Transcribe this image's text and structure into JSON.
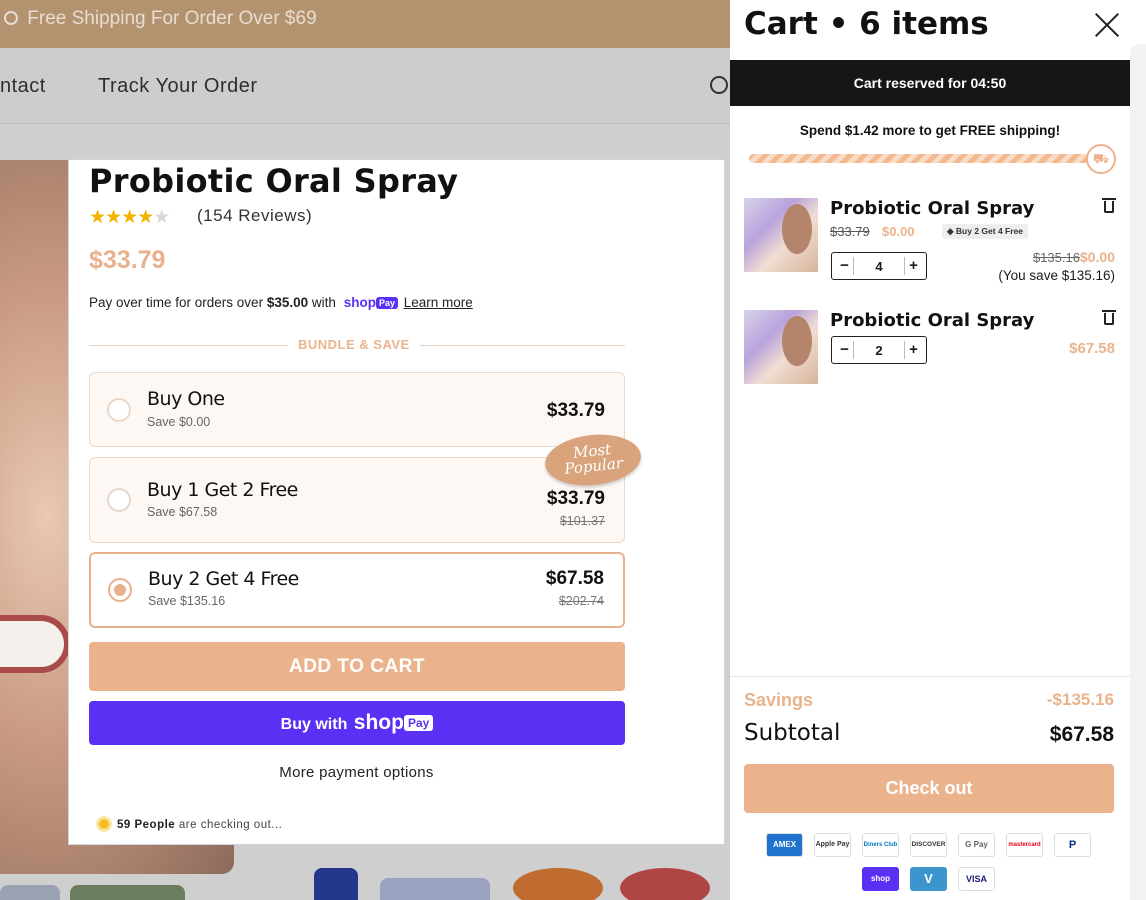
{
  "store": {
    "announcement": "Free Shipping For Order Over $69",
    "nav": [
      "ntact",
      "Track Your Order"
    ]
  },
  "product": {
    "title": "Probiotic Oral Spray",
    "rating": 4.5,
    "reviews": "(154 Reviews)",
    "price": "$33.79",
    "pay_over": {
      "prefix": "Pay over time for orders over",
      "amount": "$35.00",
      "with": "with",
      "shop": "shop",
      "pay": "Pay",
      "learn_more": "Learn more"
    },
    "bundle_label": "BUNDLE & SAVE",
    "options": [
      {
        "name": "Buy One",
        "save": "Save $0.00",
        "price": "$33.79",
        "compare": "",
        "selected": false
      },
      {
        "name": "Buy 1 Get 2 Free",
        "save": "Save $67.58",
        "price": "$33.79",
        "compare": "$101.37",
        "selected": false
      },
      {
        "name": "Buy 2 Get 4 Free",
        "save": "Save $135.16",
        "price": "$67.58",
        "compare": "$202.74",
        "selected": true
      }
    ],
    "badge": [
      "Most",
      "Popular"
    ],
    "add_to_cart": "ADD TO CART",
    "buy_with": "Buy with",
    "shop": "shop",
    "pay": "Pay",
    "more_payment": "More payment options",
    "checking": {
      "count": "59 People",
      "text": "are checking out..."
    }
  },
  "cart": {
    "title": "Cart • 6 items",
    "reserved": "Cart reserved for 04:50",
    "spend_msg": "Spend $1.42 more to get FREE shipping!",
    "progress": 0.98,
    "items": [
      {
        "name": "Probiotic Oral Spray",
        "orig_price": "$33.79",
        "price": "$0.00",
        "tag": "Buy 2 Get 4 Free",
        "qty": "4",
        "line_orig": "$135.16",
        "line_price": "$0.00",
        "save_note": "(You save $135.16)"
      },
      {
        "name": "Probiotic Oral Spray",
        "qty": "2",
        "line_price": "$67.58"
      }
    ],
    "savings_label": "Savings",
    "savings_value": "-$135.16",
    "subtotal_label": "Subtotal",
    "subtotal_value": "$67.58",
    "checkout": "Check out",
    "payment_icons": [
      "AMEX",
      "Apple Pay",
      "Diners Club",
      "DISCOVER",
      "G Pay",
      "mastercard",
      "P",
      "shop",
      "V",
      "VISA"
    ]
  },
  "colors": {
    "accent": "#ebb38c",
    "shop_purple": "#5a31f4",
    "dark": "#161616",
    "star": "#f2b400"
  }
}
